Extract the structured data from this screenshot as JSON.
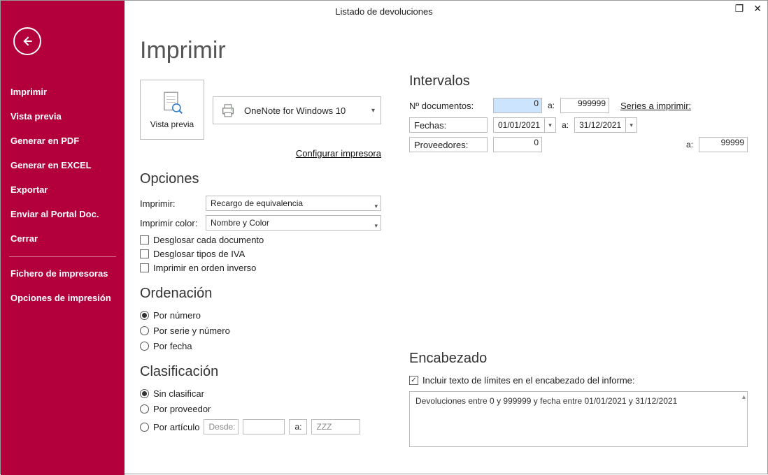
{
  "window": {
    "title": "Listado de devoluciones"
  },
  "sidebar": {
    "items": [
      {
        "label": "Imprimir"
      },
      {
        "label": "Vista previa"
      },
      {
        "label": "Generar en PDF"
      },
      {
        "label": "Generar en EXCEL"
      },
      {
        "label": "Exportar"
      },
      {
        "label": "Enviar al Portal Doc."
      },
      {
        "label": "Cerrar"
      }
    ],
    "items2": [
      {
        "label": "Fichero de impresoras"
      },
      {
        "label": "Opciones de impresión"
      }
    ]
  },
  "page": {
    "title": "Imprimir",
    "preview_label": "Vista previa",
    "printer_name": "OneNote for Windows 10",
    "configure_printer_label": "Configurar impresora"
  },
  "opciones": {
    "heading": "Opciones",
    "imprimir_label": "Imprimir:",
    "imprimir_value": "Recargo de equivalencia",
    "color_label": "Imprimir color:",
    "color_value": "Nombre y Color",
    "chk_desglosar_doc": "Desglosar cada documento",
    "chk_desglosar_iva": "Desglosar tipos de IVA",
    "chk_orden_inverso": "Imprimir en orden inverso"
  },
  "ordenacion": {
    "heading": "Ordenación",
    "r1": "Por número",
    "r2": "Por serie y número",
    "r3": "Por fecha"
  },
  "clasificacion": {
    "heading": "Clasificación",
    "r1": "Sin clasificar",
    "r2": "Por proveedor",
    "r3": "Por artículo",
    "desde_ph": "Desde:",
    "a_label": "a:",
    "zzz_ph": "ZZZ"
  },
  "intervalos": {
    "heading": "Intervalos",
    "ndoc_label": "Nº documentos:",
    "ndoc_from": "0",
    "a_label": "a:",
    "ndoc_to": "999999",
    "series_link": "Series a imprimir:",
    "fechas_label": "Fechas:",
    "fechas_from": "01/01/2021",
    "fechas_to": "31/12/2021",
    "prov_label": "Proveedores:",
    "prov_from": "0",
    "prov_to": "99999"
  },
  "encabezado": {
    "heading": "Encabezado",
    "chk_label": "Incluir texto de límites en el encabezado del informe:",
    "text": "Devoluciones entre 0 y 999999 y fecha entre 01/01/2021 y 31/12/2021"
  }
}
